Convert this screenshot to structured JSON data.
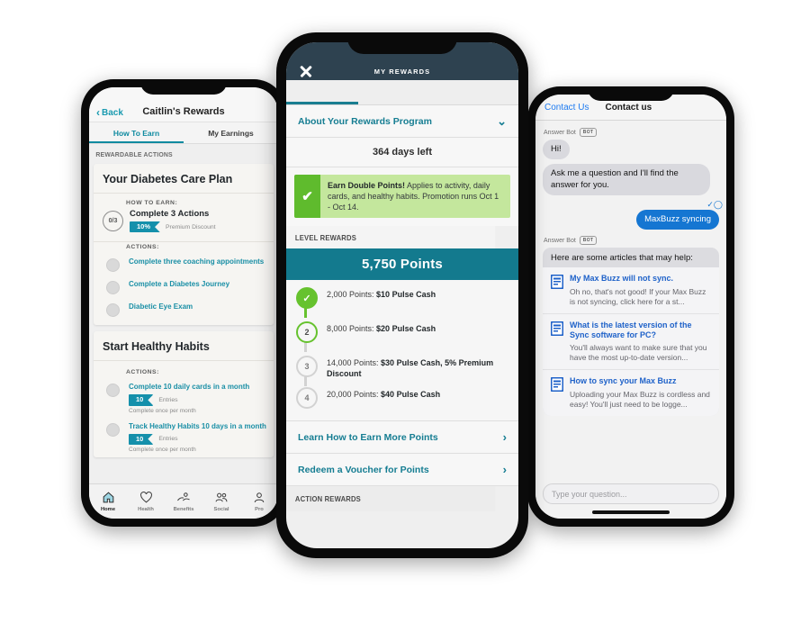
{
  "left_phone": {
    "header": {
      "back_label": "Back",
      "title": "Caitlin's Rewards"
    },
    "tabs": [
      {
        "label": "How To Earn",
        "active": true
      },
      {
        "label": "My Earnings",
        "active": false
      }
    ],
    "section_label": "REWARDABLE ACTIONS",
    "cards": [
      {
        "title": "Your Diabetes Care Plan",
        "how_to_earn_label": "HOW TO EARN:",
        "progress": "0/3",
        "goal_title": "Complete 3 Actions",
        "badge": "10%",
        "badge_note": "Premium Discount",
        "actions_label": "ACTIONS:",
        "actions": [
          {
            "text": "Complete three coaching appointments"
          },
          {
            "text": "Complete a Diabetes Journey"
          },
          {
            "text": "Diabetic Eye Exam"
          }
        ]
      },
      {
        "title": "Start Healthy Habits",
        "actions_label": "ACTIONS:",
        "actions": [
          {
            "text": "Complete 10 daily cards in a month",
            "badge": "10",
            "badge_note": "Entries",
            "sub": "Complete once per month"
          },
          {
            "text": "Track Healthy Habits 10 days in a month",
            "badge": "10",
            "badge_note": "Entries",
            "sub": "Complete once per month"
          }
        ]
      }
    ],
    "tabbar": [
      {
        "label": "Home",
        "icon": "home-icon",
        "active": true
      },
      {
        "label": "Health",
        "icon": "heart-icon",
        "active": false
      },
      {
        "label": "Benefits",
        "icon": "benefits-hand-icon",
        "active": false
      },
      {
        "label": "Social",
        "icon": "people-icon",
        "active": false
      },
      {
        "label": "Pro",
        "icon": "profile-icon",
        "active": false
      }
    ]
  },
  "center_phone": {
    "nav": {
      "title": "MY REWARDS",
      "close_icon": "close-icon"
    },
    "about_row": {
      "label": "About Your Rewards Program",
      "chevron": "chevron-down-icon"
    },
    "days_left": "364 days left",
    "promo": {
      "check_icon": "check-icon",
      "bold": "Earn Double Points!",
      "text": " Applies to activity, daily cards, and healthy habits. Promotion runs Oct 1 - Oct 14."
    },
    "level_rewards_label": "LEVEL REWARDS",
    "points_banner": "5,750 Points",
    "levels": [
      {
        "node": "✓",
        "state": "done",
        "points": "2,000 Points: ",
        "reward": "$10 Pulse Cash"
      },
      {
        "node": "2",
        "state": "cur",
        "points": "8,000 Points: ",
        "reward": "$20 Pulse Cash"
      },
      {
        "node": "3",
        "state": "todo",
        "points": "14,000 Points: ",
        "reward": "$30 Pulse Cash, 5% Premium Discount"
      },
      {
        "node": "4",
        "state": "todo",
        "points": "20,000 Points: ",
        "reward": "$40 Pulse Cash"
      }
    ],
    "links": [
      {
        "label": "Learn How to Earn More Points",
        "chevron": "chevron-right-icon"
      },
      {
        "label": "Redeem a Voucher for Points",
        "chevron": "chevron-right-icon"
      }
    ],
    "action_rewards_label": "ACTION REWARDS"
  },
  "right_phone": {
    "nav": {
      "back_label": "Contact Us",
      "title": "Contact us"
    },
    "bot_name": "Answer Bot",
    "bot_badge": "BOT",
    "messages": [
      {
        "from": "bot",
        "text": "Hi!"
      },
      {
        "from": "bot",
        "text": "Ask me a question and I'll find the answer for you."
      },
      {
        "from": "me",
        "text": "MaxBuzz syncing"
      }
    ],
    "articles_header": "Here are some articles that may help:",
    "articles": [
      {
        "icon": "article-icon",
        "title": "My Max Buzz will not sync.",
        "desc": "Oh no, that's not good! If your Max Buzz is not syncing, click here for a st..."
      },
      {
        "icon": "article-icon",
        "title": "What is the latest version of the Sync software for PC?",
        "desc": "You'll always want to make sure that you have the most up-to-date version..."
      },
      {
        "icon": "article-icon",
        "title": "How to sync your Max Buzz",
        "desc": "Uploading your Max Buzz is cordless and easy! You'll just need to be logge..."
      }
    ],
    "input_placeholder": "Type your question..."
  },
  "colors": {
    "teal": "#137a8e",
    "teal_light": "#1a9ab0",
    "navy": "#2e4250",
    "green": "#66c22e",
    "green_light": "#c4e79d",
    "blue": "#1576d2",
    "link_blue": "#1f62c9"
  }
}
